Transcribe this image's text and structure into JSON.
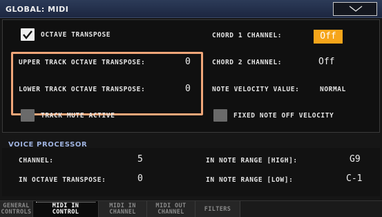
{
  "window": {
    "title": "GLOBAL: MIDI"
  },
  "main": {
    "octave_transpose": {
      "label": "OCTAVE TRANSPOSE",
      "checked": true
    },
    "upper_track": {
      "label": "UPPER TRACK OCTAVE TRANSPOSE:",
      "value": "0"
    },
    "lower_track": {
      "label": "LOWER TRACK OCTAVE TRANSPOSE:",
      "value": "0"
    },
    "track_mute": {
      "label": "TRACK MUTE ACTIVE",
      "checked": false
    },
    "chord1": {
      "label": "CHORD 1 CHANNEL:",
      "value": "Off"
    },
    "chord2": {
      "label": "CHORD 2 CHANNEL:",
      "value": "Off"
    },
    "note_velocity": {
      "label": "NOTE VELOCITY VALUE:",
      "value": "NORMAL"
    },
    "fixed_note_off": {
      "label": "FIXED NOTE OFF VELOCITY",
      "checked": false
    }
  },
  "voice_processor": {
    "title": "VOICE PROCESSOR",
    "channel": {
      "label": "CHANNEL:",
      "value": "5"
    },
    "in_octave": {
      "label": "IN OCTAVE TRANSPOSE:",
      "value": "0"
    },
    "range_high": {
      "label": "IN NOTE RANGE [HIGH]:",
      "value": "G9"
    },
    "range_low": {
      "label": "IN NOTE RANGE [LOW]:",
      "value": "C-1"
    }
  },
  "tabs": [
    {
      "line1": "GENERAL",
      "line2": "CONTROLS",
      "active": false
    },
    {
      "line1": "MIDI IN",
      "line2": "CONTROL",
      "active": true
    },
    {
      "line1": "MIDI IN",
      "line2": "CHANNEL",
      "active": false
    },
    {
      "line1": "MIDI OUT",
      "line2": "CHANNEL",
      "active": false
    },
    {
      "line1": "FILTERS",
      "line2": "",
      "active": false
    }
  ],
  "colors": {
    "accent_highlight": "#f0a679",
    "off_badge": "#f6a51a",
    "section_title": "#9fb3e0"
  },
  "icons": {
    "menu": "chevron-down-icon",
    "check": "checkmark-icon"
  }
}
